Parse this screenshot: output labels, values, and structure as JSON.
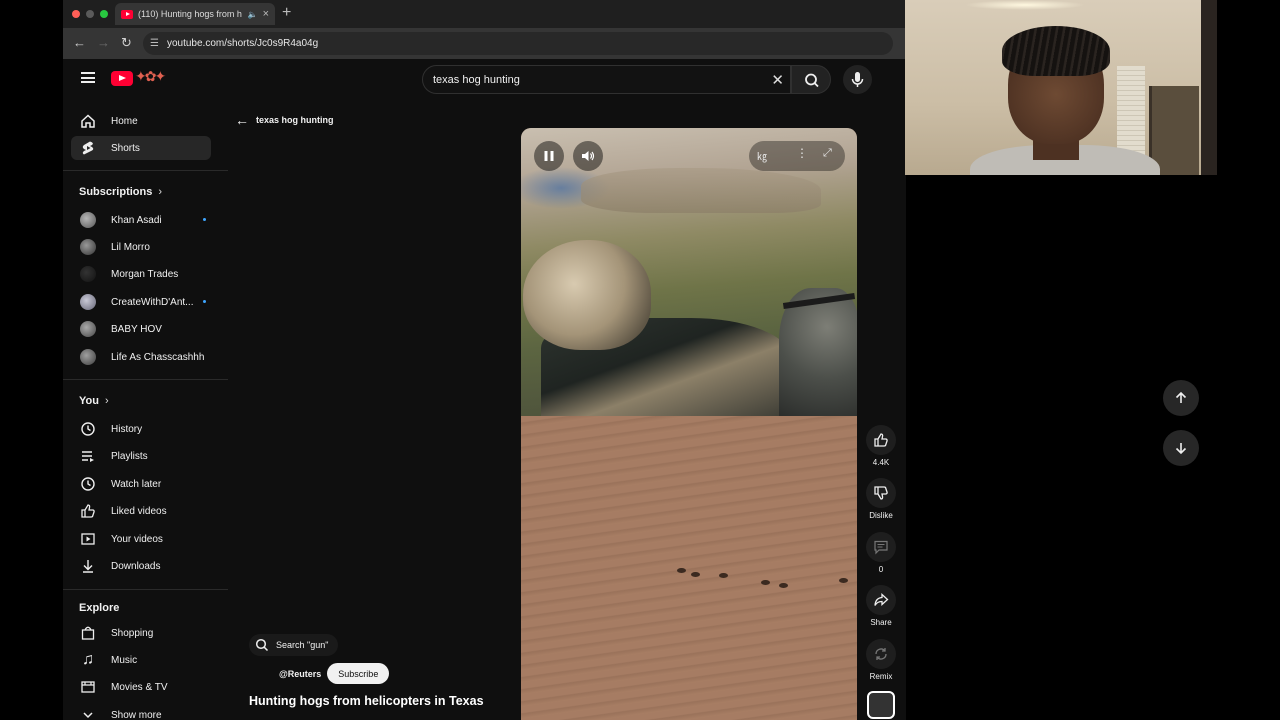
{
  "browser": {
    "tab_title": "(110) Hunting hogs from h",
    "url": "youtube.com/shorts/Jc0s9R4a04g"
  },
  "search": {
    "query": "texas hog hunting"
  },
  "sidebar": {
    "main": [
      {
        "label": "Home",
        "icon": "home-icon"
      },
      {
        "label": "Shorts",
        "icon": "shorts-icon",
        "active": true
      }
    ],
    "subscriptions_heading": "Subscriptions",
    "subscriptions": [
      {
        "label": "Khan Asadi",
        "live": true
      },
      {
        "label": "Lil Morro",
        "live": false
      },
      {
        "label": "Morgan Trades",
        "live": false
      },
      {
        "label": "CreateWithD'Ant...",
        "live": true
      },
      {
        "label": "BABY HOV",
        "live": false
      },
      {
        "label": "Life As Chasscashhh",
        "live": false
      }
    ],
    "you_heading": "You",
    "you": [
      {
        "label": "History",
        "icon": "history-icon"
      },
      {
        "label": "Playlists",
        "icon": "playlists-icon"
      },
      {
        "label": "Watch later",
        "icon": "watch-later-icon"
      },
      {
        "label": "Liked videos",
        "icon": "liked-videos-icon"
      },
      {
        "label": "Your videos",
        "icon": "your-videos-icon"
      },
      {
        "label": "Downloads",
        "icon": "downloads-icon"
      }
    ],
    "explore_heading": "Explore",
    "explore": [
      {
        "label": "Shopping",
        "icon": "shopping-icon"
      },
      {
        "label": "Music",
        "icon": "music-icon"
      },
      {
        "label": "Movies & TV",
        "icon": "movies-icon"
      },
      {
        "label": "Show more",
        "icon": "chevron-down-icon"
      }
    ]
  },
  "shorts": {
    "back_label": "texas hog hunting",
    "search_chip": "Search \"gun\"",
    "channel": "@Reuters",
    "subscribe_label": "Subscribe",
    "title": "Hunting hogs from helicopters in Texas",
    "actions": {
      "like_count": "4.4K",
      "dislike_label": "Dislike",
      "comment_count": "0",
      "share_label": "Share",
      "remix_label": "Remix"
    }
  },
  "colors": {
    "accent": "#ff0033",
    "background": "#0f0f0f",
    "live_dot": "#3ea6ff"
  }
}
